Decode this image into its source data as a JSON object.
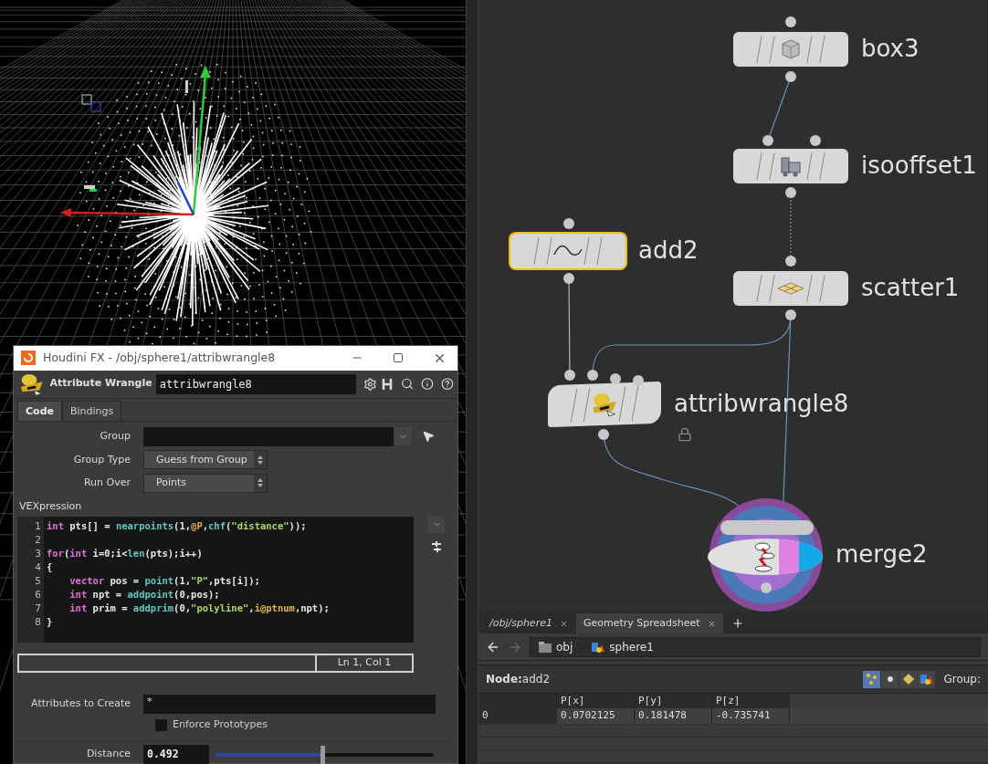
{
  "param_window": {
    "title": "Houdini FX - /obj/sphere1/attribwrangle8",
    "node_type": "Attribute Wrangle",
    "node_name": "attribwrangle8",
    "tabs": [
      {
        "label": "Code",
        "selected": true
      },
      {
        "label": "Bindings",
        "selected": false
      }
    ],
    "group": {
      "label": "Group"
    },
    "group_type": {
      "label": "Group Type",
      "value": "Guess from Group"
    },
    "run_over": {
      "label": "Run Over",
      "value": "Points"
    },
    "vexpression": {
      "label": "VEXpression",
      "cursor": "Ln 1, Col 1",
      "lines": [
        {
          "number": "1",
          "tokens": [
            {
              "kind": "keyword",
              "text": "int"
            },
            {
              "kind": "plain",
              "text": " pts[] = "
            },
            {
              "kind": "function",
              "text": "nearpoints"
            },
            {
              "kind": "plain",
              "text": "(1,"
            },
            {
              "kind": "attribute",
              "text": "@P"
            },
            {
              "kind": "plain",
              "text": ","
            },
            {
              "kind": "function",
              "text": "chf"
            },
            {
              "kind": "plain",
              "text": "("
            },
            {
              "kind": "string",
              "text": "\"distance\""
            },
            {
              "kind": "plain",
              "text": "));"
            }
          ]
        },
        {
          "number": "2"
        },
        {
          "number": "3",
          "tokens": [
            {
              "kind": "keyword",
              "text": "for"
            },
            {
              "kind": "plain",
              "text": "("
            },
            {
              "kind": "keyword",
              "text": "int"
            },
            {
              "kind": "plain",
              "text": " i=0;i<"
            },
            {
              "kind": "function",
              "text": "len"
            },
            {
              "kind": "plain",
              "text": "(pts);i++)"
            }
          ]
        },
        {
          "number": "4",
          "tokens": [
            {
              "kind": "plain",
              "text": "{"
            }
          ]
        },
        {
          "number": "5",
          "tokens": [
            {
              "kind": "keyword",
              "text": "    vector"
            },
            {
              "kind": "plain",
              "text": " pos = "
            },
            {
              "kind": "function",
              "text": "point"
            },
            {
              "kind": "plain",
              "text": "(1,"
            },
            {
              "kind": "string",
              "text": "\"P\""
            },
            {
              "kind": "plain",
              "text": ",pts[i]);"
            }
          ]
        },
        {
          "number": "6",
          "tokens": [
            {
              "kind": "keyword",
              "text": "    int"
            },
            {
              "kind": "plain",
              "text": " npt = "
            },
            {
              "kind": "function",
              "text": "addpoint"
            },
            {
              "kind": "plain",
              "text": "(0,pos);"
            }
          ]
        },
        {
          "number": "7",
          "tokens": [
            {
              "kind": "keyword",
              "text": "    int"
            },
            {
              "kind": "plain",
              "text": " prim = "
            },
            {
              "kind": "function",
              "text": "addprim"
            },
            {
              "kind": "plain",
              "text": "(0,"
            },
            {
              "kind": "string",
              "text": "\"polyline\""
            },
            {
              "kind": "plain",
              "text": ","
            },
            {
              "kind": "attribute",
              "text": "i@ptnum"
            },
            {
              "kind": "plain",
              "text": ",npt);"
            }
          ]
        },
        {
          "number": "8",
          "tokens": [
            {
              "kind": "plain",
              "text": "}"
            }
          ]
        }
      ]
    },
    "attributes_to_create": {
      "label": "Attributes to Create",
      "value": "*"
    },
    "enforce_prototypes": {
      "label": "Enforce Prototypes",
      "checked": false
    },
    "distance": {
      "label": "Distance",
      "value": "0.492",
      "level": 0.49
    }
  },
  "network": {
    "nodes": [
      {
        "kind": "box",
        "label": "box3",
        "selected": false,
        "locked": false
      },
      {
        "kind": "isooffset",
        "label": "isooffset1",
        "selected": false,
        "locked": false
      },
      {
        "kind": "add",
        "label": "add2",
        "selected": true,
        "locked": false
      },
      {
        "kind": "scatter",
        "label": "scatter1",
        "selected": false,
        "locked": false
      },
      {
        "kind": "wrangle",
        "label": "attribwrangle8",
        "selected": false,
        "locked": true
      },
      {
        "kind": "merge",
        "label": "merge2",
        "selected": false,
        "locked": false
      }
    ]
  },
  "pane_tabs": [
    {
      "label": "/obj/sphere1",
      "selected": false
    },
    {
      "label": "Geometry Spreadsheet",
      "selected": true
    }
  ],
  "path": [
    "obj",
    "sphere1"
  ],
  "spreadsheet": {
    "node_label": "Node:",
    "node_name": "add2",
    "group_label": "Group:",
    "modes": [
      {
        "kind": "points",
        "selected": true
      },
      {
        "kind": "vertices",
        "selected": false
      },
      {
        "kind": "primitives",
        "selected": false
      },
      {
        "kind": "detail",
        "selected": false
      }
    ],
    "columns": [
      "P[x]",
      "P[y]",
      "P[z]"
    ],
    "rows": [
      {
        "index": "0",
        "values": [
          "0.0702125",
          "0.181478",
          "-0.735741"
        ]
      }
    ]
  }
}
